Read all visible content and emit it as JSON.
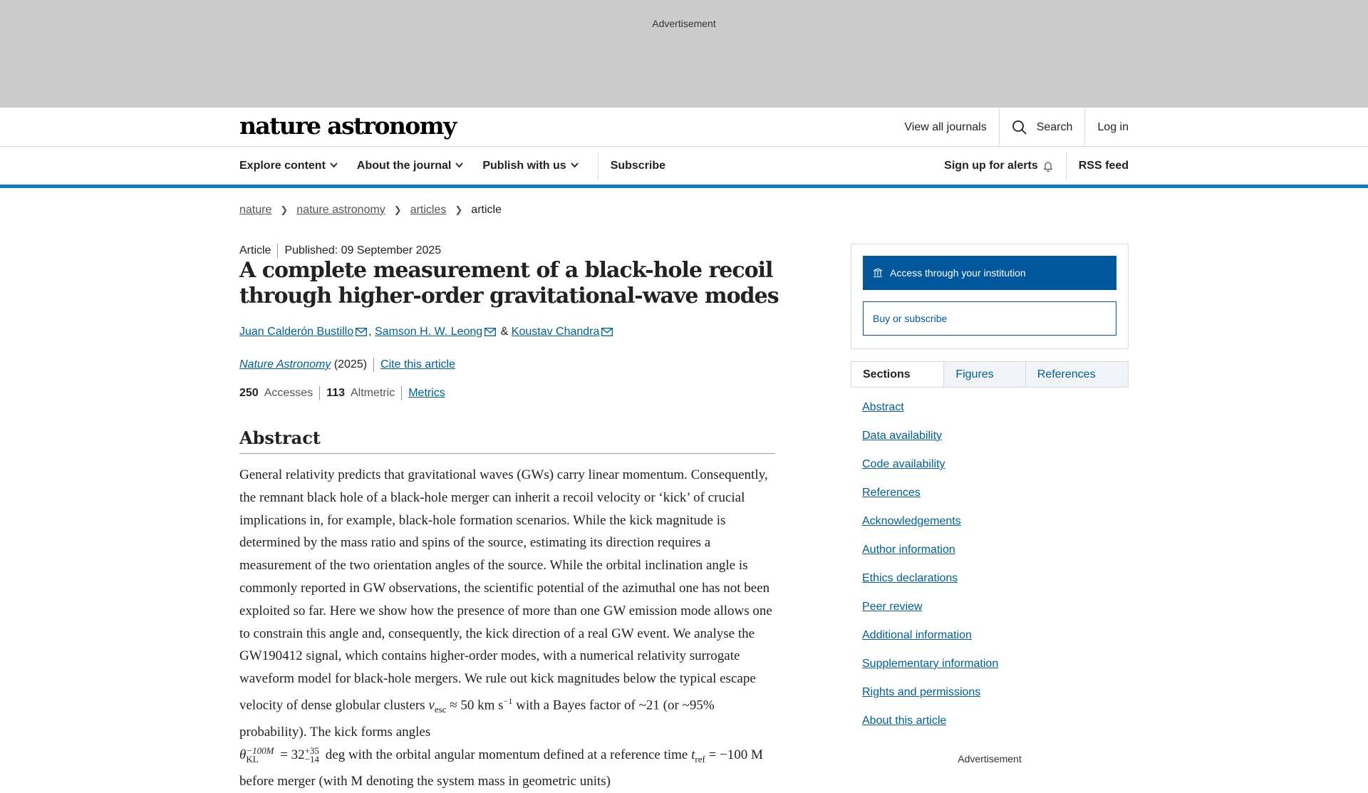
{
  "ad": {
    "label": "Advertisement"
  },
  "header": {
    "logo": "nature astronomy",
    "view_all": "View all journals",
    "search": "Search",
    "login": "Log in"
  },
  "nav": {
    "explore": "Explore content",
    "about": "About the journal",
    "publish": "Publish with us",
    "subscribe": "Subscribe",
    "alerts": "Sign up for alerts",
    "rss": "RSS feed"
  },
  "breadcrumb": {
    "items": [
      "nature",
      "nature astronomy",
      "articles"
    ],
    "current": "article"
  },
  "article": {
    "type": "Article",
    "published": "Published: 09 September 2025",
    "title_line1": "A complete measurement of a black-hole recoil",
    "title_line2": "through higher-order gravitational-wave modes",
    "authors": [
      "Juan Calderón Bustillo",
      "Samson H. W. Leong",
      "Koustav Chandra"
    ],
    "author_sep1": ",",
    "author_sep2": "&",
    "journal": "Nature Astronomy",
    "year": "(2025)",
    "cite": "Cite this article",
    "accesses_count": "250",
    "accesses_label": "Accesses",
    "altmetric_count": "113",
    "altmetric_label": "Altmetric",
    "metrics": "Metrics"
  },
  "abstract": {
    "heading": "Abstract",
    "text_part1": "General relativity predicts that gravitational waves (GWs) carry linear momentum. Consequently, the remnant black hole of a black-hole merger can inherit a recoil velocity or ‘kick’ of crucial implications in, for example, black-hole formation scenarios. While the kick magnitude is determined by the mass ratio and spins of the source, estimating its direction requires a measurement of the two orientation angles of the source. While the orbital inclination angle is commonly reported in GW observations, the scientific potential of the azimuthal one has not been exploited so far. Here we show how the presence of more than one GW emission mode allows one to constrain this angle and, consequently, the kick direction of a real GW event. We analyse the GW190412 signal, which contains higher-order modes, with a numerical relativity surrogate waveform model for black-hole mergers. We rule out kick magnitudes below the typical escape velocity of dense globular clusters",
    "v_esc": "v",
    "v_esc_sub": "esc",
    "approx": "≈ 50 km s",
    "unit_sup": "−1",
    "text_part2": "with a Bayes factor of ~21 (or ~95% probability). The kick forms angles",
    "theta": "θ",
    "theta_sub": "KL",
    "theta_sup": "−100M",
    "equals_32": "= 32",
    "err_plus": "+35",
    "err_minus": "−14",
    "deg": "deg",
    "text_part3": "with the orbital angular momentum defined at a reference time",
    "t_ref": "t",
    "t_ref_sub": "ref",
    "text_part4": "= −100 M before merger (with M denoting the system mass in geometric units)"
  },
  "sidebar": {
    "access_btn": "Access through your institution",
    "buy_btn": "Buy or subscribe",
    "tabs": [
      "Sections",
      "Figures",
      "References"
    ],
    "sections": [
      "Abstract",
      "Data availability",
      "Code availability",
      "References",
      "Acknowledgements",
      "Author information",
      "Ethics declarations",
      "Peer review",
      "Additional information",
      "Supplementary information",
      "Rights and permissions",
      "About this article"
    ],
    "ad_label": "Advertisement"
  },
  "colors": {
    "accent_blue": "#0f7bc4",
    "link": "#025e8d",
    "button": "#01579b",
    "ad_bg": "#cccccc"
  }
}
